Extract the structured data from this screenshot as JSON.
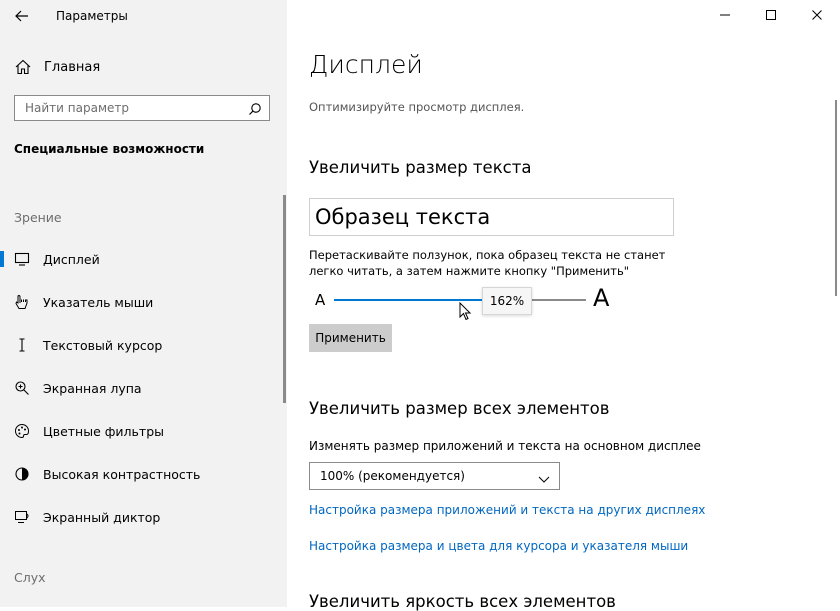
{
  "window": {
    "app_title": "Параметры",
    "back_icon": "back-arrow-icon",
    "controls": [
      "minimize-icon",
      "maximize-icon",
      "close-icon"
    ]
  },
  "sidebar": {
    "home": {
      "label": "Главная",
      "icon": "home-icon"
    },
    "search": {
      "placeholder": "Найти параметр",
      "icon": "search-icon"
    },
    "section_title": "Специальные возможности",
    "group_vision": "Зрение",
    "items": [
      {
        "label": "Дисплей",
        "icon": "display-icon",
        "active": true
      },
      {
        "label": "Указатель мыши",
        "icon": "mouse-pointer-icon"
      },
      {
        "label": "Текстовый курсор",
        "icon": "text-cursor-icon"
      },
      {
        "label": "Экранная лупа",
        "icon": "magnifier-icon"
      },
      {
        "label": "Цветные фильтры",
        "icon": "color-filters-icon"
      },
      {
        "label": "Высокая контрастность",
        "icon": "high-contrast-icon"
      },
      {
        "label": "Экранный диктор",
        "icon": "narrator-icon"
      }
    ],
    "group_hearing": "Слух"
  },
  "main": {
    "title": "Дисплей",
    "description": "Оптимизируйте просмотр дисплея.",
    "text_size": {
      "heading": "Увеличить размер текста",
      "sample": "Образец текста",
      "hint": "Перетаскивайте ползунок, пока образец текста не станет легко читать, а затем нажмите кнопку \"Применить\"",
      "slider_min_label": "A",
      "slider_max_label": "A",
      "slider_value": 0.62,
      "tooltip": "162%",
      "apply_label": "Применить"
    },
    "scale": {
      "heading": "Увеличить размер всех элементов",
      "label": "Изменять размер приложений и текста на основном дисплее",
      "dropdown_value": "100% (рекомендуется)",
      "link1": "Настройка размера приложений и текста на других дисплеях",
      "link2": "Настройка размера и цвета для курсора и указателя мыши"
    },
    "brightness_heading": "Увеличить яркость всех элементов"
  },
  "colors": {
    "accent": "#0078d4",
    "link": "#0067c0",
    "sidebar_bg": "#f2f2f2"
  }
}
